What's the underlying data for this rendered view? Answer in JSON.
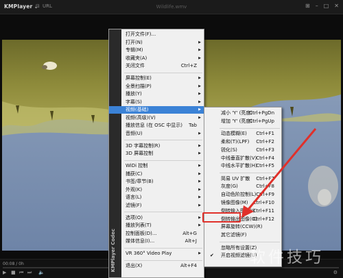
{
  "titlebar": {
    "logo": "KMPlayer",
    "url_label": "URL",
    "title": "Wildlife.wmv"
  },
  "player": {
    "time": "00:08 / 0h"
  },
  "main_menu": [
    {
      "label": "打开文件(F)...",
      "shortcut": "",
      "sub": false
    },
    {
      "label": "打开(N)",
      "shortcut": "",
      "sub": true
    },
    {
      "label": "专辑(M)",
      "shortcut": "",
      "sub": true
    },
    {
      "label": "收藏夹(A)",
      "shortcut": "",
      "sub": true
    },
    {
      "label": "关闭文件",
      "shortcut": "Ctrl+Z",
      "sub": false,
      "sep_after": true
    },
    {
      "label": "屏幕控制(E)",
      "shortcut": "",
      "sub": true
    },
    {
      "label": "全景扫描(P)",
      "shortcut": "",
      "sub": true
    },
    {
      "label": "播放(Y)",
      "shortcut": "",
      "sub": true
    },
    {
      "label": "字幕(S)",
      "shortcut": "",
      "sub": true
    },
    {
      "label": "视频(基础)",
      "shortcut": "",
      "sub": true,
      "highlight": true
    },
    {
      "label": "视频(高级)(V)",
      "shortcut": "",
      "sub": true
    },
    {
      "label": "播放信息 (在 OSC 中显示)",
      "shortcut": "Tab",
      "sub": false
    },
    {
      "label": "音频(U)",
      "shortcut": "",
      "sub": true,
      "sep_after": true
    },
    {
      "label": "3D 字幕控制(R)",
      "shortcut": "",
      "sub": true
    },
    {
      "label": "3D 屏幕控制",
      "shortcut": "",
      "sub": true,
      "sep_after": true
    },
    {
      "label": "WiDi 控制",
      "shortcut": "",
      "sub": true
    },
    {
      "label": "捕获(C)",
      "shortcut": "",
      "sub": true
    },
    {
      "label": "书签/章节(B)",
      "shortcut": "",
      "sub": true
    },
    {
      "label": "外观(K)",
      "shortcut": "",
      "sub": true
    },
    {
      "label": "语言(L)",
      "shortcut": "",
      "sub": true
    },
    {
      "label": "滤镜(F)",
      "shortcut": "",
      "sub": true,
      "sep_after": true
    },
    {
      "label": "选项(O)",
      "shortcut": "",
      "sub": true
    },
    {
      "label": "播放列表(T)",
      "shortcut": "",
      "sub": true
    },
    {
      "label": "控制面板(D)...",
      "shortcut": "Alt+G",
      "sub": false
    },
    {
      "label": "媒体信息(I)...",
      "shortcut": "Alt+J",
      "sub": false,
      "sep_after": true
    },
    {
      "label": "VR 360° Video Play",
      "shortcut": "",
      "sub": true,
      "sep_after": true
    },
    {
      "label": "退出(X)",
      "shortcut": "Alt+F4",
      "sub": false
    }
  ],
  "main_menu_brand": "KMPlayer Codec",
  "sub_menu": [
    {
      "label": "减小 'Y' (亮度)",
      "shortcut": "Ctrl+PgDn"
    },
    {
      "label": "增加 'Y' (亮度)",
      "shortcut": "Ctrl+PgUp",
      "sep_after": true
    },
    {
      "label": "动态模糊(E)",
      "shortcut": "Ctrl+F1"
    },
    {
      "label": "柔和(T)(LPF)",
      "shortcut": "Ctrl+F2"
    },
    {
      "label": "锐化(S)",
      "shortcut": "Ctrl+F3"
    },
    {
      "label": "中线垂直扩散(V)",
      "shortcut": "Ctrl+F4"
    },
    {
      "label": "中线水平扩散(H)",
      "shortcut": "Ctrl+F5",
      "sep_after": true
    },
    {
      "label": "简易 UV 扩散",
      "shortcut": "Ctrl+F7"
    },
    {
      "label": "灰度(G)",
      "shortcut": "Ctrl+F8"
    },
    {
      "label": "自动色阶控制(L)",
      "shortcut": "Ctrl+F9"
    },
    {
      "label": "镜像图像(M)",
      "shortcut": "Ctrl+F10"
    },
    {
      "label": "倒转输入图像(I)",
      "shortcut": "Ctrl+F11",
      "boxed": true
    },
    {
      "label": "倒转输出图像(O)",
      "shortcut": "Ctrl+F12"
    },
    {
      "label": "屏幕旋转(CCW)(R)",
      "shortcut": ""
    },
    {
      "label": "其它滤镜(F)",
      "shortcut": "",
      "sep_after": true
    },
    {
      "label": "忽略所有设置(Z)",
      "shortcut": ""
    },
    {
      "label": "开启视频滤镜(U)",
      "shortcut": "",
      "checked": true
    }
  ],
  "watermark": "软件技巧",
  "colors": {
    "highlight": "#3b82d6",
    "annotation": "#e0302a",
    "menu_bg": "#f0f0f0"
  }
}
